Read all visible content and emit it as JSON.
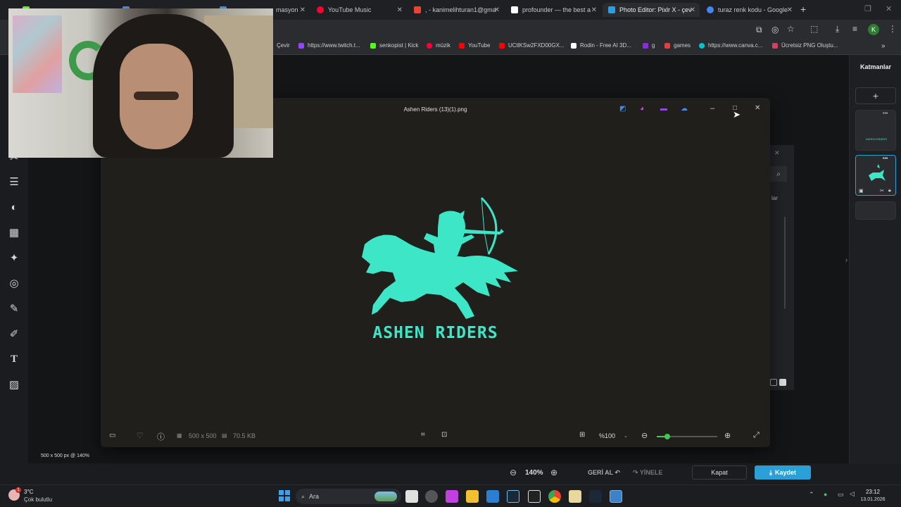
{
  "browser": {
    "tabs": [
      {
        "label": "YouTube Music",
        "color": "#ff0033"
      },
      {
        "label": ", - kanimelihturan1@gma",
        "color": "#ea4335"
      },
      {
        "label": "profounder — the best a",
        "color": "#ffffff"
      },
      {
        "label": "Photo Editor: Pixlr X - çev",
        "color": "#2aa0e0"
      },
      {
        "label": "turaz renk kodu - Google",
        "color": "#4285f4"
      }
    ],
    "tab_partial": "masyon",
    "new_tab": "+",
    "bookmarks": [
      {
        "label": "Çevir",
        "color": "#4285f4"
      },
      {
        "label": "https://www.twitch.t...",
        "color": "#9146ff"
      },
      {
        "label": "senkopist | Kick",
        "color": "#53fc18"
      },
      {
        "label": "müzik",
        "color": "#ff0033"
      },
      {
        "label": "YouTube",
        "color": "#ff0000"
      },
      {
        "label": "UCtlKSw2FXD00GX...",
        "color": "#ff0000"
      },
      {
        "label": "Rodin - Free AI 3D...",
        "color": "#ffffff"
      },
      {
        "label": "g",
        "color": "#8a2be2"
      },
      {
        "label": "games",
        "color": "#e04040"
      },
      {
        "label": "https://www.canva.c...",
        "color": "#00c4cc"
      },
      {
        "label": "Ücretsiz PNG Oluştu...",
        "color": "#d04060"
      }
    ],
    "more_bookmarks": "»",
    "profile_initial": "K"
  },
  "pixlr": {
    "layers_title": "Katmanlar",
    "add_layer": "+",
    "layer_menu": "•••",
    "layer1_text": "ASHEN RIDERS",
    "canvas_info": "500 x 500 px @ 140%",
    "zoom": "140%",
    "undo": "GERİ AL",
    "redo": "YİNELE",
    "close": "Kapat",
    "save": "Kaydet",
    "panel_fragment": "lar",
    "accent": "#2b9fd8"
  },
  "viewer": {
    "title": "Ashen Riders (13)(1).png",
    "logo_text": "ASHEN RIDERS",
    "logo_color": "#3ee6c8",
    "dimensions": "500 x 500",
    "file_size": "70.5 KB",
    "zoom_value": "%100",
    "zoom_slider_fraction": 0.18
  },
  "taskbar": {
    "weather_temp": "3°C",
    "weather_desc": "Çok bulutlu",
    "weather_badge": "1",
    "search_label": "Ara",
    "time": "23:12",
    "date": "13.01.2026"
  }
}
